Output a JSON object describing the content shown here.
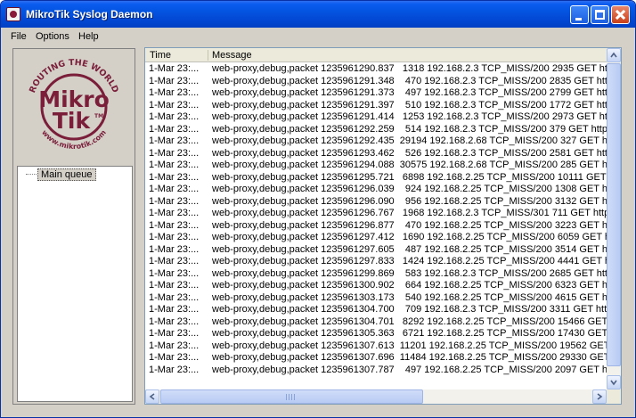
{
  "window": {
    "title": "MikroTik Syslog Daemon"
  },
  "menu": [
    "File",
    "Options",
    "Help"
  ],
  "logo": {
    "top_text": "ROUTING THE WORLD",
    "line1": "Mikro",
    "line2": "Tik",
    "tm": "TM",
    "bottom_text": "www.mikrotik.com",
    "color": "#7a1e3a"
  },
  "tree": {
    "items": [
      {
        "label": "Main queue"
      }
    ]
  },
  "list": {
    "columns": [
      "Time",
      "Message"
    ],
    "rows": [
      {
        "time": "1-Mar 23:...",
        "message": "web-proxy,debug,packet 1235961290.837   1318 192.168.2.3 TCP_MISS/200 2935 GET htt"
      },
      {
        "time": "1-Mar 23:...",
        "message": "web-proxy,debug,packet 1235961291.348    470 192.168.2.3 TCP_MISS/200 2835 GET http"
      },
      {
        "time": "1-Mar 23:...",
        "message": "web-proxy,debug,packet 1235961291.373    497 192.168.2.3 TCP_MISS/200 2799 GET http"
      },
      {
        "time": "1-Mar 23:...",
        "message": "web-proxy,debug,packet 1235961291.397    510 192.168.2.3 TCP_MISS/200 1772 GET http"
      },
      {
        "time": "1-Mar 23:...",
        "message": "web-proxy,debug,packet 1235961291.414   1253 192.168.2.3 TCP_MISS/200 2973 GET htt"
      },
      {
        "time": "1-Mar 23:...",
        "message": "web-proxy,debug,packet 1235961292.259    514 192.168.2.3 TCP_MISS/200 379 GET http"
      },
      {
        "time": "1-Mar 23:...",
        "message": "web-proxy,debug,packet 1235961292.435  29194 192.168.2.68 TCP_MISS/200 327 GET htt"
      },
      {
        "time": "1-Mar 23:...",
        "message": "web-proxy,debug,packet 1235961293.462    526 192.168.2.3 TCP_MISS/200 2581 GET htt"
      },
      {
        "time": "1-Mar 23:...",
        "message": "web-proxy,debug,packet 1235961294.088  30575 192.168.2.68 TCP_MISS/200 285 GET htt"
      },
      {
        "time": "1-Mar 23:...",
        "message": "web-proxy,debug,packet 1235961295.721   6898 192.168.2.25 TCP_MISS/200 10111 GET"
      },
      {
        "time": "1-Mar 23:...",
        "message": "web-proxy,debug,packet 1235961296.039    924 192.168.2.25 TCP_MISS/200 1308 GET ht"
      },
      {
        "time": "1-Mar 23:...",
        "message": "web-proxy,debug,packet 1235961296.090    956 192.168.2.25 TCP_MISS/200 3132 GET ht"
      },
      {
        "time": "1-Mar 23:...",
        "message": "web-proxy,debug,packet 1235961296.767   1968 192.168.2.3 TCP_MISS/301 711 GET http"
      },
      {
        "time": "1-Mar 23:...",
        "message": "web-proxy,debug,packet 1235961296.877    470 192.168.2.25 TCP_MISS/200 3223 GET ht"
      },
      {
        "time": "1-Mar 23:...",
        "message": "web-proxy,debug,packet 1235961297.412   1690 192.168.2.25 TCP_MISS/200 6059 GET h"
      },
      {
        "time": "1-Mar 23:...",
        "message": "web-proxy,debug,packet 1235961297.605    487 192.168.2.25 TCP_MISS/200 3514 GET ht"
      },
      {
        "time": "1-Mar 23:...",
        "message": "web-proxy,debug,packet 1235961297.833   1424 192.168.2.25 TCP_MISS/200 4441 GET h"
      },
      {
        "time": "1-Mar 23:...",
        "message": "web-proxy,debug,packet 1235961299.869    583 192.168.2.3 TCP_MISS/200 2685 GET htt"
      },
      {
        "time": "1-Mar 23:...",
        "message": "web-proxy,debug,packet 1235961300.902    664 192.168.2.25 TCP_MISS/200 6323 GET ht"
      },
      {
        "time": "1-Mar 23:...",
        "message": "web-proxy,debug,packet 1235961303.173    540 192.168.2.25 TCP_MISS/200 4615 GET ht"
      },
      {
        "time": "1-Mar 23:...",
        "message": "web-proxy,debug,packet 1235961304.700    709 192.168.2.3 TCP_MISS/200 3311 GET htt"
      },
      {
        "time": "1-Mar 23:...",
        "message": "web-proxy,debug,packet 1235961304.701   8292 192.168.2.25 TCP_MISS/200 15466 GET"
      },
      {
        "time": "1-Mar 23:...",
        "message": "web-proxy,debug,packet 1235961305.363   6721 192.168.2.25 TCP_MISS/200 17430 GET"
      },
      {
        "time": "1-Mar 23:...",
        "message": "web-proxy,debug,packet 1235961307.613  11201 192.168.2.25 TCP_MISS/200 19562 GET"
      },
      {
        "time": "1-Mar 23:...",
        "message": "web-proxy,debug,packet 1235961307.696  11484 192.168.2.25 TCP_MISS/200 29330 GET"
      },
      {
        "time": "1-Mar 23:...",
        "message": "web-proxy,debug,packet 1235961307.787    497 192.168.2.25 TCP_MISS/200 2097 GET h"
      }
    ]
  }
}
